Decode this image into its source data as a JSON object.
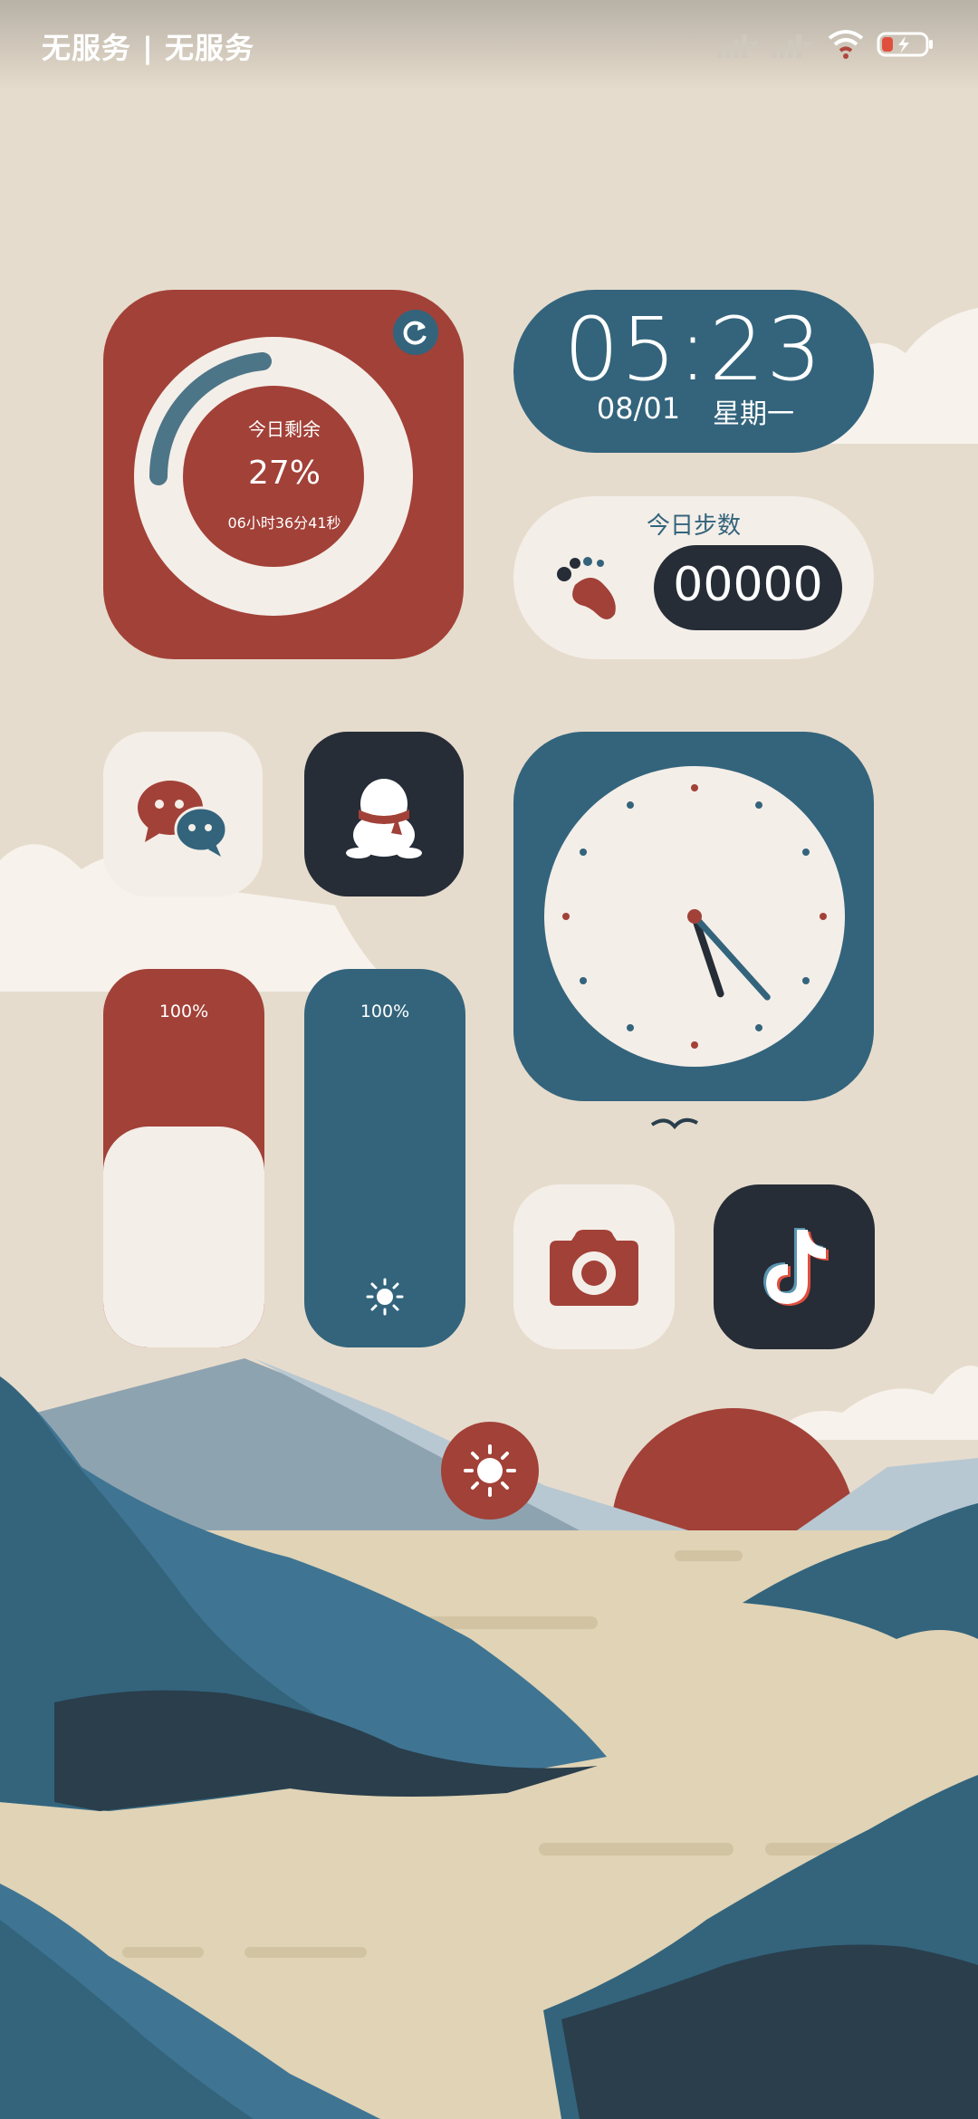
{
  "status_bar": {
    "carrier_text": "无服务 | 无服务",
    "icons": [
      "signal-icon",
      "signal-icon",
      "wifi-icon",
      "battery-charging-icon"
    ]
  },
  "day_progress_widget": {
    "title": "今日剩余",
    "percent": "27%",
    "remaining": "06小时36分41秒",
    "refresh_icon": "refresh-icon"
  },
  "clock_widget": {
    "time": "05:23",
    "date": "08/01",
    "weekday": "星期一"
  },
  "steps_widget": {
    "title": "今日步数",
    "count": "00000",
    "icon": "footprints-icon"
  },
  "apps": [
    {
      "name": "wechat",
      "icon": "wechat-icon"
    },
    {
      "name": "qq",
      "icon": "qq-penguin-icon"
    },
    {
      "name": "camera",
      "icon": "camera-icon"
    },
    {
      "name": "douyin",
      "icon": "tiktok-icon"
    }
  ],
  "volume_slider": {
    "label": "100%",
    "level_percent": 100
  },
  "brightness_slider": {
    "label": "100%",
    "level_percent": 100,
    "icon": "sun-icon"
  },
  "analog_clock": {
    "hour": 5,
    "minute": 23
  },
  "weather_button": {
    "icon": "sun-icon"
  },
  "colors": {
    "red": "#a24138",
    "blue": "#33647c",
    "cream": "#f4eee8",
    "dark": "#262d37",
    "background": "#e6dccd"
  }
}
